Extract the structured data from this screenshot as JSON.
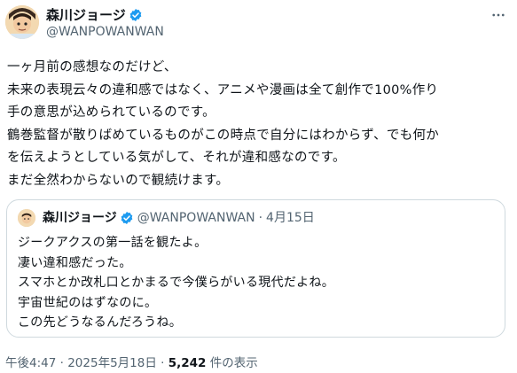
{
  "author": {
    "display_name": "森川ジョージ",
    "handle": "@WANPOWANWAN"
  },
  "icons": {
    "verified": "verified-badge-icon",
    "more": "more-options-icon"
  },
  "colors": {
    "verified": "#1d9bf0",
    "secondary_text": "#536471",
    "border": "#cfd9de"
  },
  "tweet": {
    "lines": [
      "一ヶ月前の感想なのだけど、",
      "未来の表現云々の違和感ではなく、アニメや漫画は全て創作で100%作り",
      "手の意思が込められているのです。",
      "鶴巻監督が散りばめているものがこの時点で自分にはわからず、でも何か",
      "を伝えようとしている気がして、それが違和感なのです。",
      "まだ全然わからないので観続けます。"
    ]
  },
  "quoted": {
    "display_name": "森川ジョージ",
    "handle": "@WANPOWANWAN",
    "separator": "·",
    "date": "4月15日",
    "lines": [
      "ジークアクスの第一話を観たよ。",
      "凄い違和感だった。",
      "スマホとか改札口とかまるで今僕らがいる現代だよね。",
      "宇宙世紀のはずなのに。",
      "この先どうなるんだろうね。"
    ]
  },
  "meta": {
    "time": "午後4:47",
    "separator": "·",
    "date": "2025年5月18日",
    "views_count": "5,242",
    "views_label": "件の表示"
  }
}
